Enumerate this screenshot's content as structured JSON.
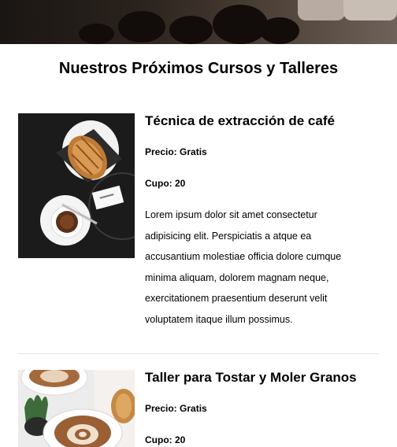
{
  "section": {
    "title": "Nuestros Próximos Cursos y Talleres"
  },
  "courses": [
    {
      "title": "Técnica de extracción de café",
      "price": "Precio: Gratis",
      "seats": "Cupo: 20",
      "description": "Lorem ipsum dolor sit amet consectetur adipisicing elit. Perspiciatis a atque ea accusantium molestiae officia dolore cumque minima aliquam, dolorem magnam neque, exercitationem praesentium deserunt velit voluptatem itaque illum possimus."
    },
    {
      "title": "Taller para Tostar y Moler Granos",
      "price": "Precio: Gratis",
      "seats": "Cupo: 20"
    }
  ]
}
